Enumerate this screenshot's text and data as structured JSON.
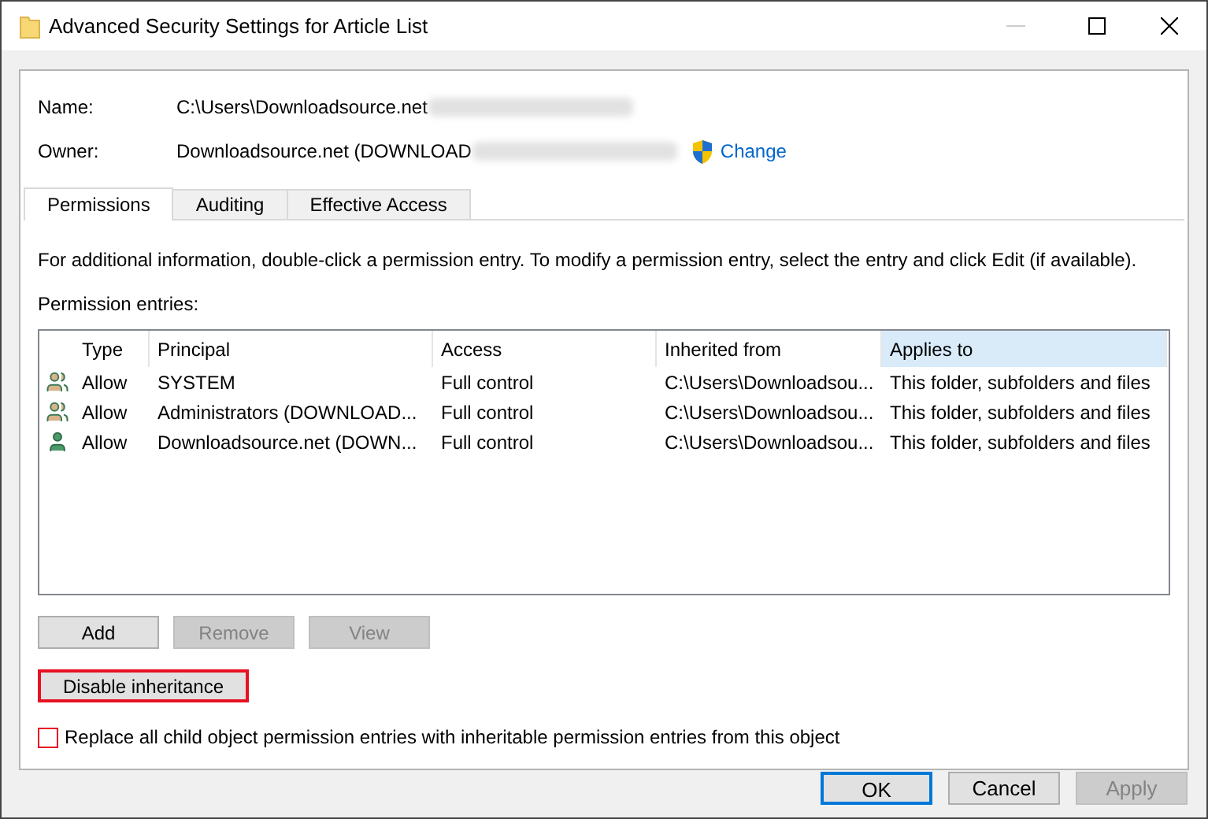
{
  "window": {
    "title": "Advanced Security Settings for Article List"
  },
  "name": {
    "label": "Name:",
    "value": "C:\\Users\\Downloadsource.net",
    "redacted": true
  },
  "owner": {
    "label": "Owner:",
    "value": "Downloadsource.net (DOWNLOAD",
    "redacted": true,
    "link": "Change"
  },
  "tabs": [
    {
      "label": "Permissions",
      "selected": true
    },
    {
      "label": "Auditing",
      "selected": false
    },
    {
      "label": "Effective Access",
      "selected": false
    }
  ],
  "info": "For additional information, double-click a permission entry. To modify a permission entry, select the entry and click Edit (if available).",
  "entries_label": "Permission entries:",
  "table": {
    "columns": [
      {
        "label": "Type",
        "selected": false
      },
      {
        "label": "Principal",
        "selected": false
      },
      {
        "label": "Access",
        "selected": false
      },
      {
        "label": "Inherited from",
        "selected": false
      },
      {
        "label": "Applies to",
        "selected": true
      }
    ],
    "rows": [
      {
        "kind": "group",
        "cells": [
          "Allow",
          "SYSTEM",
          "Full control",
          "C:\\Users\\Downloadsou...",
          "This folder, subfolders and files"
        ]
      },
      {
        "kind": "group",
        "cells": [
          "Allow",
          "Administrators (DOWNLOAD...",
          "Full control",
          "C:\\Users\\Downloadsou...",
          "This folder, subfolders and files"
        ]
      },
      {
        "kind": "user",
        "cells": [
          "Allow",
          "Downloadsource.net (DOWN...",
          "Full control",
          "C:\\Users\\Downloadsou...",
          "This folder, subfolders and files"
        ]
      }
    ]
  },
  "list_buttons": [
    {
      "label": "Add",
      "disabled": false
    },
    {
      "label": "Remove",
      "disabled": true
    },
    {
      "label": "View",
      "disabled": true
    }
  ],
  "inheritance_button": {
    "label": "Disable inheritance",
    "highlighted": true
  },
  "replace_checkbox": {
    "label": "Replace all child object permission entries with inheritable permission entries from this object",
    "checked": false,
    "highlighted": true
  },
  "footer_buttons": [
    {
      "label": "OK",
      "disabled": false,
      "default": true
    },
    {
      "label": "Cancel",
      "disabled": false,
      "default": false
    },
    {
      "label": "Apply",
      "disabled": true,
      "default": false
    }
  ]
}
